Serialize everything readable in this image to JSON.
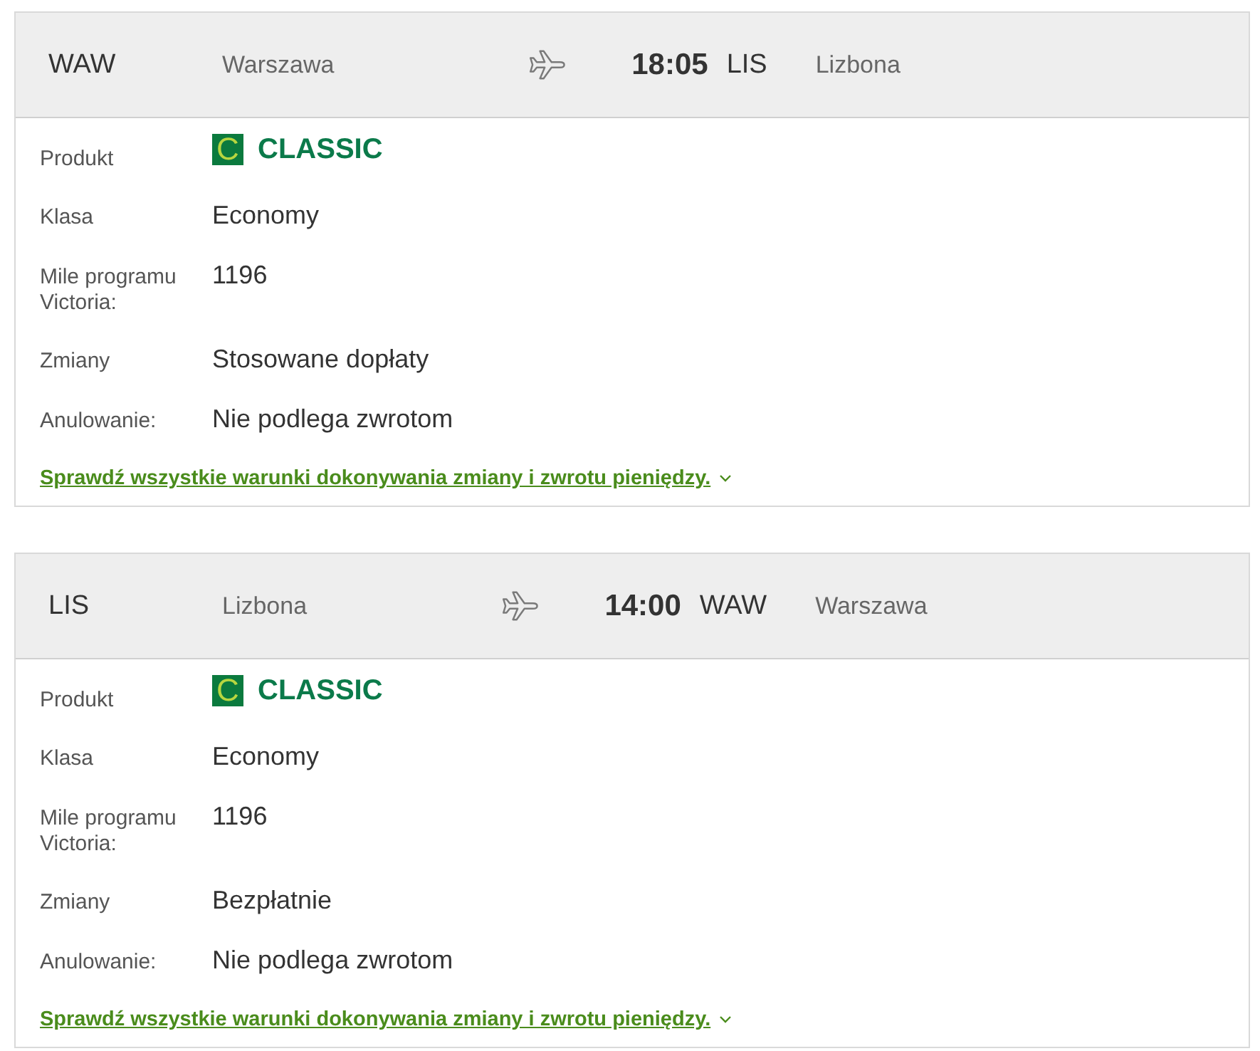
{
  "flights": [
    {
      "origin": {
        "code": "WAW",
        "city": "Warszawa"
      },
      "time": "18:05",
      "destination": {
        "code": "LIS",
        "city": "Lizbona"
      },
      "details": [
        {
          "kind": "product",
          "label": "Produkt",
          "mark": "C",
          "value": "CLASSIC"
        },
        {
          "kind": "text",
          "label": "Klasa",
          "value": "Economy"
        },
        {
          "kind": "text",
          "label": "Mile programu Victoria:",
          "value": "1196"
        },
        {
          "kind": "text",
          "label": "Zmiany",
          "value": "Stosowane dopłaty"
        },
        {
          "kind": "text",
          "label": "Anulowanie:",
          "value": "Nie podlega zwrotom"
        }
      ],
      "conditions_link": "Sprawdź wszystkie warunki dokonywania zmiany i zwrotu pieniędzy."
    },
    {
      "origin": {
        "code": "LIS",
        "city": "Lizbona"
      },
      "time": "14:00",
      "destination": {
        "code": "WAW",
        "city": "Warszawa"
      },
      "details": [
        {
          "kind": "product",
          "label": "Produkt",
          "mark": "C",
          "value": "CLASSIC"
        },
        {
          "kind": "text",
          "label": "Klasa",
          "value": "Economy"
        },
        {
          "kind": "text",
          "label": "Mile programu Victoria:",
          "value": "1196"
        },
        {
          "kind": "text",
          "label": "Zmiany",
          "value": "Bezpłatnie"
        },
        {
          "kind": "text",
          "label": "Anulowanie:",
          "value": "Nie podlega zwrotom"
        }
      ],
      "conditions_link": "Sprawdź wszystkie warunki dokonywania zmiany i zwrotu pieniędzy."
    }
  ]
}
